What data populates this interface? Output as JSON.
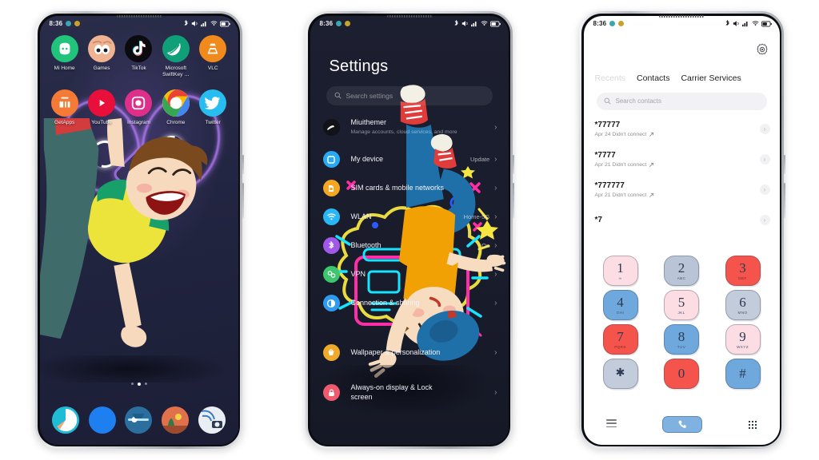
{
  "meta": {
    "background": "#ffffff",
    "phone_count": 3
  },
  "statusbar": {
    "time": "8:36",
    "dot1_color": "#3aa6b0",
    "dot2_color": "#c9a227",
    "icons": [
      "bluetooth-icon",
      "vibrate-icon",
      "signal-icon",
      "wifi-icon",
      "battery-icon"
    ]
  },
  "phone1": {
    "name": "home-screen",
    "apps_row1": [
      {
        "label": "Mi Home",
        "icon": "mi-home-icon",
        "color": "#21c47a"
      },
      {
        "label": "Games",
        "icon": "games-icon",
        "color": "#f0b392"
      },
      {
        "label": "TikTok",
        "icon": "tiktok-icon",
        "color": "#0b0b0f"
      },
      {
        "label": "Microsoft SwiftKey …",
        "icon": "swiftkey-icon",
        "color": "#0fa07a"
      },
      {
        "label": "VLC",
        "icon": "vlc-icon",
        "color": "#f08a1c"
      }
    ],
    "apps_row2": [
      {
        "label": "GetApps",
        "icon": "getapps-icon",
        "color": "#f47a35"
      },
      {
        "label": "YouTube",
        "icon": "youtube-icon",
        "color": "#e8103a"
      },
      {
        "label": "Instagram",
        "icon": "instagram-icon",
        "color": "#e02f8a"
      },
      {
        "label": "Chrome",
        "icon": "chrome-icon",
        "color": "#ffffff"
      },
      {
        "label": "Twitter",
        "icon": "twitter-icon",
        "color": "#28bdf0"
      }
    ],
    "dock": [
      {
        "name": "themes-icon",
        "color": "#1fbcd6"
      },
      {
        "name": "browser-icon",
        "color": "#1d7ff0"
      },
      {
        "name": "settings-icon",
        "color": "#2b6f9e"
      },
      {
        "name": "gallery-icon",
        "color": "#e0714a"
      },
      {
        "name": "camera-icon",
        "color": "#e9edf4"
      }
    ],
    "page_dots": 3,
    "active_dot": 1
  },
  "phone2": {
    "name": "settings-screen",
    "title": "Settings",
    "search_placeholder": "Search settings",
    "items": [
      {
        "title": "Miuithemer",
        "subtitle": "Manage accounts, cloud services, and more",
        "value": "",
        "icon": "account-avatar-icon",
        "color": "#101218"
      },
      {
        "title": "My device",
        "subtitle": "",
        "value": "Update",
        "icon": "device-icon",
        "color": "#29a8f5"
      },
      {
        "title": "SIM cards & mobile networks",
        "subtitle": "",
        "value": "",
        "icon": "sim-icon",
        "color": "#f5a623"
      },
      {
        "title": "WLAN",
        "subtitle": "",
        "value": "Home-5G",
        "icon": "wifi-icon",
        "color": "#29b6f5"
      },
      {
        "title": "Bluetooth",
        "subtitle": "",
        "value": "On",
        "icon": "bluetooth-icon",
        "color": "#a158e8"
      },
      {
        "title": "VPN",
        "subtitle": "",
        "value": "",
        "icon": "vpn-icon",
        "color": "#3dc66d"
      },
      {
        "title": "Connection & sharing",
        "subtitle": "",
        "value": "",
        "icon": "connection-icon",
        "color": "#2e9bf0"
      },
      {
        "title": "Wallpaper & personalization",
        "subtitle": "",
        "value": "",
        "icon": "wallpaper-icon",
        "color": "#f0a92a"
      },
      {
        "title": "Always-on display & Lock screen",
        "subtitle": "",
        "value": "",
        "icon": "lock-icon",
        "color": "#ef5a6f"
      }
    ]
  },
  "phone3": {
    "name": "dialer-screen",
    "gear_icon": "settings-gear-icon",
    "tabs": [
      {
        "label": "Recents",
        "active": false,
        "dim": true
      },
      {
        "label": "Contacts",
        "active": true,
        "dim": false
      },
      {
        "label": "Carrier Services",
        "active": false,
        "dim": false
      }
    ],
    "search_placeholder": "Search contacts",
    "calls": [
      {
        "number": "*77777",
        "meta": "Apr 24 Didn't connect",
        "arrow": "outgoing-arrow-icon"
      },
      {
        "number": "*7777",
        "meta": "Apr 21 Didn't connect",
        "arrow": "outgoing-arrow-icon"
      },
      {
        "number": "*777777",
        "meta": "Apr 21 Didn't connect",
        "arrow": "outgoing-arrow-icon"
      },
      {
        "number": "*7",
        "meta": "",
        "arrow": ""
      }
    ],
    "keypad": [
      [
        {
          "num": "1",
          "letters": "∞",
          "color": "#fbdde3"
        },
        {
          "num": "2",
          "letters": "ABC",
          "color": "#b9c4d6"
        },
        {
          "num": "3",
          "letters": "DEF",
          "color": "#f4544b"
        }
      ],
      [
        {
          "num": "4",
          "letters": "GHI",
          "color": "#6fa8dc"
        },
        {
          "num": "5",
          "letters": "JKL",
          "color": "#fbdde3"
        },
        {
          "num": "6",
          "letters": "MNO",
          "color": "#c3ccdb"
        }
      ],
      [
        {
          "num": "7",
          "letters": "PQRS",
          "color": "#f4544b"
        },
        {
          "num": "8",
          "letters": "TUV",
          "color": "#6fa8dc"
        },
        {
          "num": "9",
          "letters": "WXYZ",
          "color": "#fbdde3"
        }
      ],
      [
        {
          "num": "✱",
          "letters": "",
          "color": "#c3ccdb"
        },
        {
          "num": "0",
          "letters": "",
          "color": "#f4544b"
        },
        {
          "num": "#",
          "letters": "",
          "color": "#6fa8dc"
        }
      ]
    ],
    "bottom": {
      "menu_icon": "menu-icon",
      "call_icon": "call-handset-icon",
      "call_button_color": "#7fb2e0",
      "keypad_icon": "dialpad-grid-icon"
    }
  }
}
